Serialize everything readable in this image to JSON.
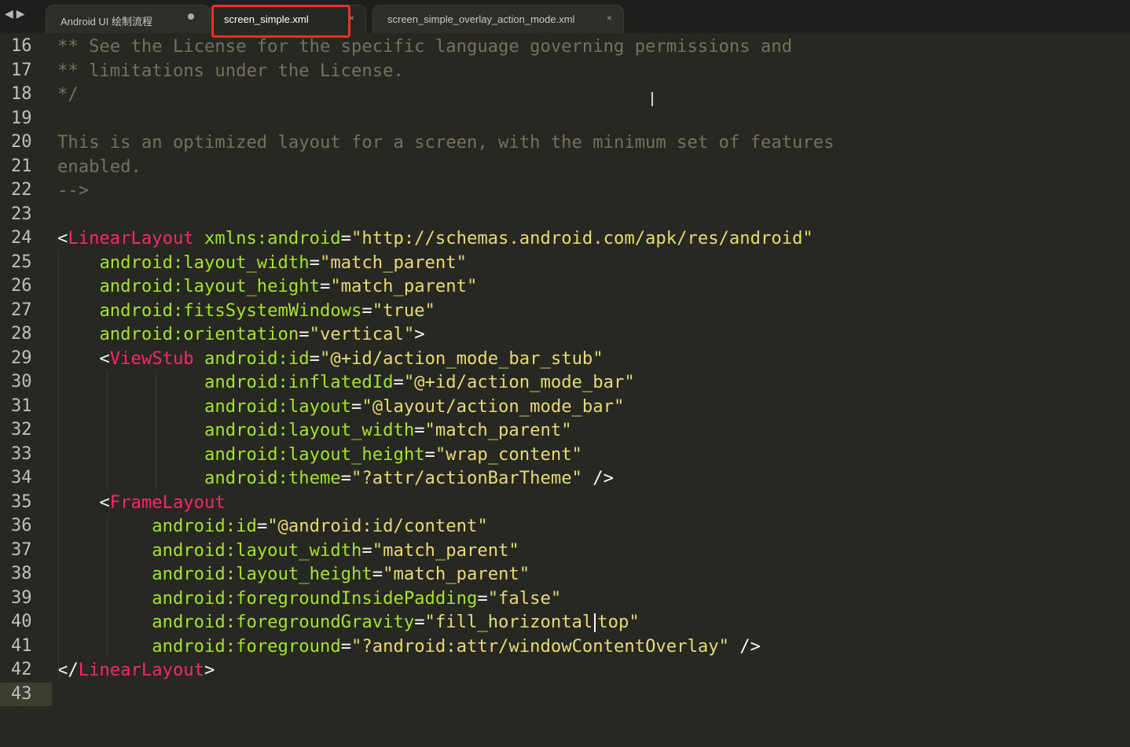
{
  "tabs": [
    {
      "label": "Android UI 绘制流程",
      "state": "modified"
    },
    {
      "label": "screen_simple.xml",
      "state": "active"
    },
    {
      "label": "screen_simple_overlay_action_mode.xml",
      "state": "closable"
    }
  ],
  "nav": {
    "back_icon": "◀",
    "forward_icon": "▶"
  },
  "colors": {
    "background": "#272822",
    "comment": "#75715e",
    "tag": "#f92672",
    "attribute": "#a6e22e",
    "string": "#e6db74",
    "highlight_border": "#e8332a"
  },
  "current_line": "43",
  "lines": [
    {
      "n": "16",
      "parts": [
        [
          "c",
          "** See the License for the specific language governing permissions and"
        ]
      ]
    },
    {
      "n": "17",
      "parts": [
        [
          "c",
          "** limitations under the License."
        ]
      ]
    },
    {
      "n": "18",
      "parts": [
        [
          "c",
          "*/"
        ]
      ]
    },
    {
      "n": "19",
      "parts": []
    },
    {
      "n": "20",
      "parts": [
        [
          "c",
          "This is an optimized layout for a screen, with the minimum set of features"
        ]
      ]
    },
    {
      "n": "21",
      "parts": [
        [
          "c",
          "enabled."
        ]
      ]
    },
    {
      "n": "22",
      "parts": [
        [
          "c",
          "-->"
        ]
      ]
    },
    {
      "n": "23",
      "parts": []
    },
    {
      "n": "24",
      "parts": [
        [
          "p",
          "<"
        ],
        [
          "t",
          "LinearLayout"
        ],
        [
          "p",
          " "
        ],
        [
          "a",
          "xmlns:android"
        ],
        [
          "p",
          "="
        ],
        [
          "s",
          "\"http://schemas.android.com/apk/res/android\""
        ]
      ]
    },
    {
      "n": "25",
      "parts": [
        [
          "p",
          "    "
        ],
        [
          "a",
          "android:layout_width"
        ],
        [
          "p",
          "="
        ],
        [
          "s",
          "\"match_parent\""
        ]
      ]
    },
    {
      "n": "26",
      "parts": [
        [
          "p",
          "    "
        ],
        [
          "a",
          "android:layout_height"
        ],
        [
          "p",
          "="
        ],
        [
          "s",
          "\"match_parent\""
        ]
      ]
    },
    {
      "n": "27",
      "parts": [
        [
          "p",
          "    "
        ],
        [
          "a",
          "android:fitsSystemWindows"
        ],
        [
          "p",
          "="
        ],
        [
          "s",
          "\"true\""
        ]
      ]
    },
    {
      "n": "28",
      "parts": [
        [
          "p",
          "    "
        ],
        [
          "a",
          "android:orientation"
        ],
        [
          "p",
          "="
        ],
        [
          "s",
          "\"vertical\""
        ],
        [
          "p",
          ">"
        ]
      ]
    },
    {
      "n": "29",
      "parts": [
        [
          "p",
          "    <"
        ],
        [
          "t",
          "ViewStub"
        ],
        [
          "p",
          " "
        ],
        [
          "a",
          "android:id"
        ],
        [
          "p",
          "="
        ],
        [
          "s",
          "\"@+id/action_mode_bar_stub\""
        ]
      ]
    },
    {
      "n": "30",
      "parts": [
        [
          "p",
          "              "
        ],
        [
          "a",
          "android:inflatedId"
        ],
        [
          "p",
          "="
        ],
        [
          "s",
          "\"@+id/action_mode_bar\""
        ]
      ]
    },
    {
      "n": "31",
      "parts": [
        [
          "p",
          "              "
        ],
        [
          "a",
          "android:layout"
        ],
        [
          "p",
          "="
        ],
        [
          "s",
          "\"@layout/action_mode_bar\""
        ]
      ]
    },
    {
      "n": "32",
      "parts": [
        [
          "p",
          "              "
        ],
        [
          "a",
          "android:layout_width"
        ],
        [
          "p",
          "="
        ],
        [
          "s",
          "\"match_parent\""
        ]
      ]
    },
    {
      "n": "33",
      "parts": [
        [
          "p",
          "              "
        ],
        [
          "a",
          "android:layout_height"
        ],
        [
          "p",
          "="
        ],
        [
          "s",
          "\"wrap_content\""
        ]
      ]
    },
    {
      "n": "34",
      "parts": [
        [
          "p",
          "              "
        ],
        [
          "a",
          "android:theme"
        ],
        [
          "p",
          "="
        ],
        [
          "s",
          "\"?attr/actionBarTheme\""
        ],
        [
          "p",
          " />"
        ]
      ]
    },
    {
      "n": "35",
      "parts": [
        [
          "p",
          "    <"
        ],
        [
          "t",
          "FrameLayout"
        ]
      ]
    },
    {
      "n": "36",
      "parts": [
        [
          "p",
          "         "
        ],
        [
          "a",
          "android:id"
        ],
        [
          "p",
          "="
        ],
        [
          "s",
          "\"@android:id/content\""
        ]
      ]
    },
    {
      "n": "37",
      "parts": [
        [
          "p",
          "         "
        ],
        [
          "a",
          "android:layout_width"
        ],
        [
          "p",
          "="
        ],
        [
          "s",
          "\"match_parent\""
        ]
      ]
    },
    {
      "n": "38",
      "parts": [
        [
          "p",
          "         "
        ],
        [
          "a",
          "android:layout_height"
        ],
        [
          "p",
          "="
        ],
        [
          "s",
          "\"match_parent\""
        ]
      ]
    },
    {
      "n": "39",
      "parts": [
        [
          "p",
          "         "
        ],
        [
          "a",
          "android:foregroundInsidePadding"
        ],
        [
          "p",
          "="
        ],
        [
          "s",
          "\"false\""
        ]
      ]
    },
    {
      "n": "40",
      "parts": [
        [
          "p",
          "         "
        ],
        [
          "a",
          "android:foregroundGravity"
        ],
        [
          "p",
          "="
        ],
        [
          "s",
          "\"fill_horizontal"
        ],
        [
          "caret",
          ""
        ],
        [
          "s",
          "top\""
        ]
      ]
    },
    {
      "n": "41",
      "parts": [
        [
          "p",
          "         "
        ],
        [
          "a",
          "android:foreground"
        ],
        [
          "p",
          "="
        ],
        [
          "s",
          "\"?android:attr/windowContentOverlay\""
        ],
        [
          "p",
          " />"
        ]
      ]
    },
    {
      "n": "42",
      "parts": [
        [
          "p",
          "</"
        ],
        [
          "t",
          "LinearLayout"
        ],
        [
          "p",
          ">"
        ]
      ]
    },
    {
      "n": "43",
      "parts": []
    }
  ]
}
